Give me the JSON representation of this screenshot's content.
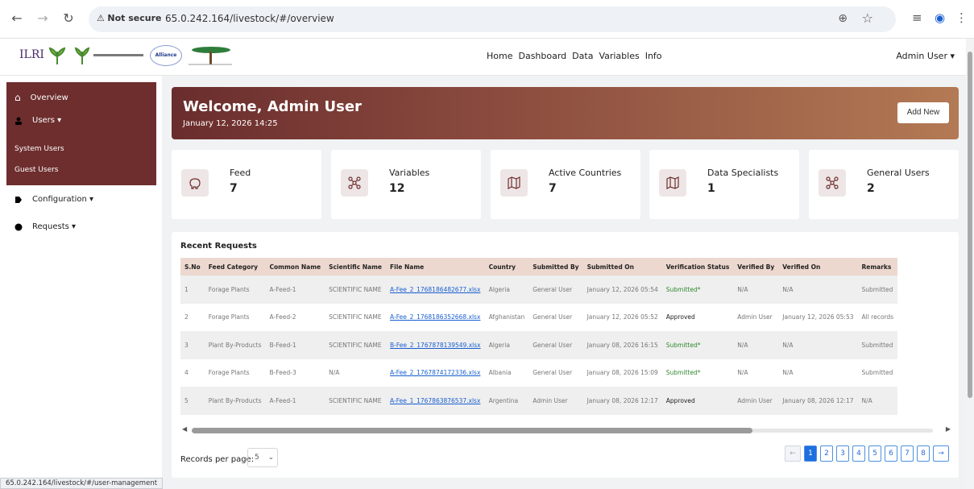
{
  "browser": {
    "security_label": "Not secure",
    "url": "65.0.242.164/livestock/#/overview",
    "status_url": "65.0.242.164/livestock/#/user-management"
  },
  "header": {
    "logo_text": "ILRI",
    "nav": [
      "Home",
      "Dashboard",
      "Data",
      "Variables",
      "Info"
    ],
    "user_menu": "Admin User ▾"
  },
  "sidebar": {
    "overview": "Overview",
    "users": "Users ▾",
    "system_users": "System Users",
    "guest_users": "Guest Users",
    "configuration": "Configuration ▾",
    "requests": "Requests ▾"
  },
  "banner": {
    "title": "Welcome, Admin User",
    "datetime": "January 12, 2026 14:25",
    "add_new": "Add New"
  },
  "stats": [
    {
      "label": "Feed",
      "value": "7",
      "icon": "pig-icon"
    },
    {
      "label": "Variables",
      "value": "12",
      "icon": "network-icon"
    },
    {
      "label": "Active Countries",
      "value": "7",
      "icon": "map-icon"
    },
    {
      "label": "Data Specialists",
      "value": "1",
      "icon": "map-icon"
    },
    {
      "label": "General Users",
      "value": "2",
      "icon": "network-icon"
    }
  ],
  "recent_requests": {
    "title": "Recent Requests",
    "columns": [
      "S.No",
      "Feed Category",
      "Common Name",
      "Scientific Name",
      "File Name",
      "Country",
      "Submitted By",
      "Submitted On",
      "Verification Status",
      "Verified By",
      "Verified On",
      "Remarks"
    ],
    "rows": [
      [
        "1",
        "Forage Plants",
        "A-Feed-1",
        "SCIENTIFIC NAME",
        "A-Fee_2_1768186482677.xlsx",
        "Algeria",
        "General User",
        "January 12, 2026 05:54",
        "Submitted*",
        "N/A",
        "N/A",
        "Submitted"
      ],
      [
        "2",
        "Forage Plants",
        "A-Feed-2",
        "SCIENTIFIC NAME",
        "A-Fee_2_1768186352668.xlsx",
        "Afghanistan",
        "General User",
        "January 12, 2026 05:52",
        "Approved",
        "Admin User",
        "January 12, 2026 05:53",
        "All records"
      ],
      [
        "3",
        "Plant By-Products",
        "B-Feed-1",
        "SCIENTIFIC NAME",
        "B-Fee_2_1767878139549.xlsx",
        "Algeria",
        "General User",
        "January 08, 2026 16:15",
        "Submitted*",
        "N/A",
        "N/A",
        "Submitted"
      ],
      [
        "4",
        "Forage Plants",
        "B-Feed-3",
        "N/A",
        "A-Fee_2_1767874172336.xlsx",
        "Albania",
        "General User",
        "January 08, 2026 15:09",
        "Submitted*",
        "N/A",
        "N/A",
        "Submitted"
      ],
      [
        "5",
        "Plant By-Products",
        "A-Feed-1",
        "SCIENTIFIC NAME",
        "A-Fee_1_1767863876537.xlsx",
        "Argentina",
        "Admin User",
        "January 08, 2026 12:17",
        "Approved",
        "Admin User",
        "January 08, 2026 12:17",
        "N/A"
      ]
    ]
  },
  "pagination": {
    "records_label": "Records per page:",
    "records_value": "5",
    "prev": "←",
    "pages": [
      "1",
      "2",
      "3",
      "4",
      "5",
      "6",
      "7",
      "8"
    ],
    "next": "→",
    "active_page": "1"
  }
}
